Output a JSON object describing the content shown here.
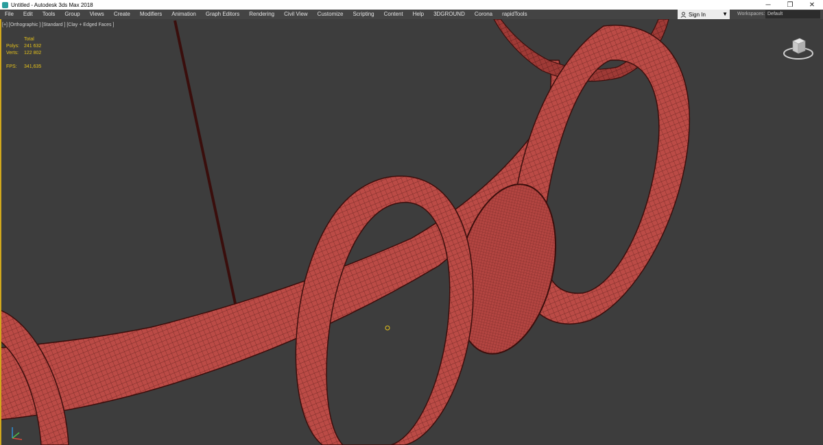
{
  "window": {
    "title": "Untitled - Autodesk 3ds Max 2018",
    "controls": {
      "minimize": "─",
      "restore": "❐",
      "close": "✕"
    }
  },
  "menu": {
    "items": [
      "File",
      "Edit",
      "Tools",
      "Group",
      "Views",
      "Create",
      "Modifiers",
      "Animation",
      "Graph Editors",
      "Rendering",
      "Civil View",
      "Customize",
      "Scripting",
      "Content",
      "Help",
      "3DGROUND",
      "Corona",
      "rapidTools"
    ]
  },
  "account": {
    "sign_in_label": "Sign In"
  },
  "workspaces": {
    "label": "Workspaces:",
    "value": "Default"
  },
  "viewport": {
    "label": "[+] [Orthographic ] [Standard ] [Clay + Edged Faces ]",
    "stats": {
      "header": "Total",
      "polys_label": "Polys:",
      "polys_value": "241 632",
      "verts_label": "Verts:",
      "verts_value": "122 802",
      "fps_label": "FPS:",
      "fps_value": "341,635"
    }
  },
  "colors": {
    "viewport_bg": "#3d3d3d",
    "mesh_fill": "#bb4b46",
    "mesh_wire": "#4a1412",
    "stats_text": "#e6c21a",
    "active_border": "#d1a81d"
  },
  "icons": {
    "app": "3ds-max-icon",
    "user": "user-icon",
    "dropdown": "caret-down-icon",
    "viewcube": "viewcube-icon",
    "axis": "axis-tripod-icon"
  }
}
